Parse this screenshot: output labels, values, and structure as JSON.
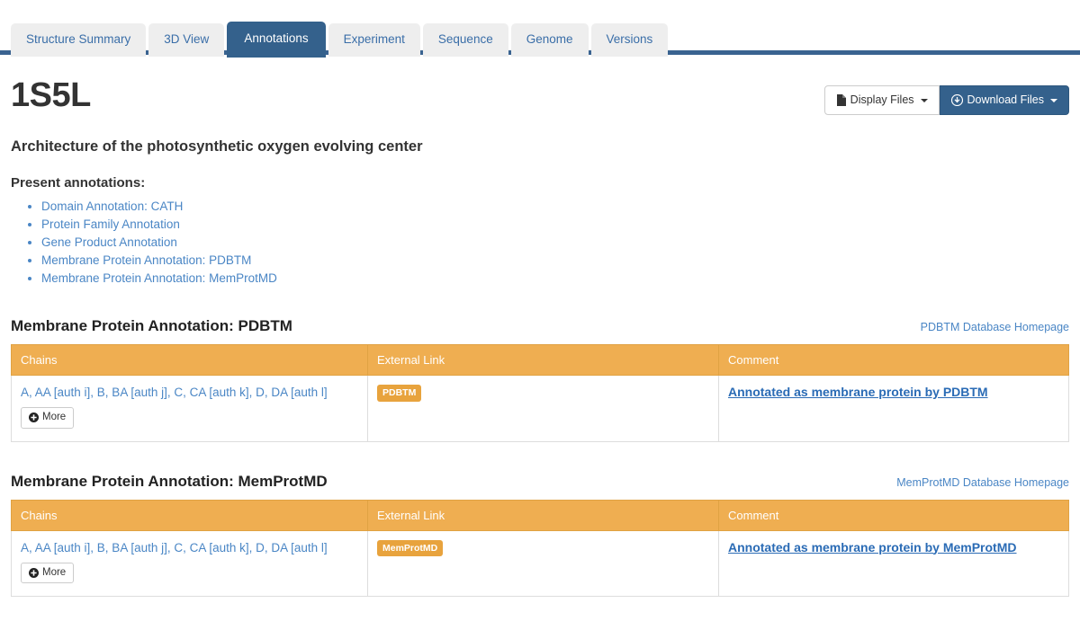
{
  "tabs": [
    {
      "label": "Structure Summary",
      "active": false
    },
    {
      "label": "3D View",
      "active": false
    },
    {
      "label": "Annotations",
      "active": true
    },
    {
      "label": "Experiment",
      "active": false
    },
    {
      "label": "Sequence",
      "active": false
    },
    {
      "label": "Genome",
      "active": false
    },
    {
      "label": "Versions",
      "active": false
    }
  ],
  "header": {
    "pdb_id": "1S5L",
    "structure_title": "Architecture of the photosynthetic oxygen evolving center",
    "display_files_label": "Display Files",
    "display_files_icon": "file-icon",
    "download_files_label": "Download Files",
    "download_files_icon": "download-circle-icon"
  },
  "annotations_section": {
    "heading": "Present annotations:",
    "items": [
      {
        "label": "Domain Annotation: CATH"
      },
      {
        "label": "Protein Family Annotation"
      },
      {
        "label": "Gene Product Annotation"
      },
      {
        "label": "Membrane Protein Annotation: PDBTM"
      },
      {
        "label": "Membrane Protein Annotation: MemProtMD"
      }
    ]
  },
  "tables": [
    {
      "title": "Membrane Protein Annotation: PDBTM",
      "db_homepage_label": "PDBTM Database Homepage",
      "columns": [
        "Chains",
        "External Link",
        "Comment"
      ],
      "rows": [
        {
          "chains": "A, AA [auth i], B, BA [auth j], C, CA [auth k], D, DA [auth l]",
          "more_label": "More",
          "badge": "PDBTM",
          "comment": "Annotated as membrane protein by PDBTM"
        }
      ]
    },
    {
      "title": "Membrane Protein Annotation: MemProtMD",
      "db_homepage_label": "MemProtMD Database Homepage",
      "columns": [
        "Chains",
        "External Link",
        "Comment"
      ],
      "rows": [
        {
          "chains": "A, AA [auth i], B, BA [auth j], C, CA [auth k], D, DA [auth l]",
          "more_label": "More",
          "badge": "MemProtMD",
          "comment": "Annotated as membrane protein by MemProtMD"
        }
      ]
    }
  ],
  "colors": {
    "tab_active": "#34618c",
    "tab_inactive": "#eeeeee",
    "link_blue": "#4a86c5",
    "table_header_orange": "#efae51",
    "badge_orange": "#e8a33d",
    "comment_link_blue": "#2a6bb5"
  }
}
